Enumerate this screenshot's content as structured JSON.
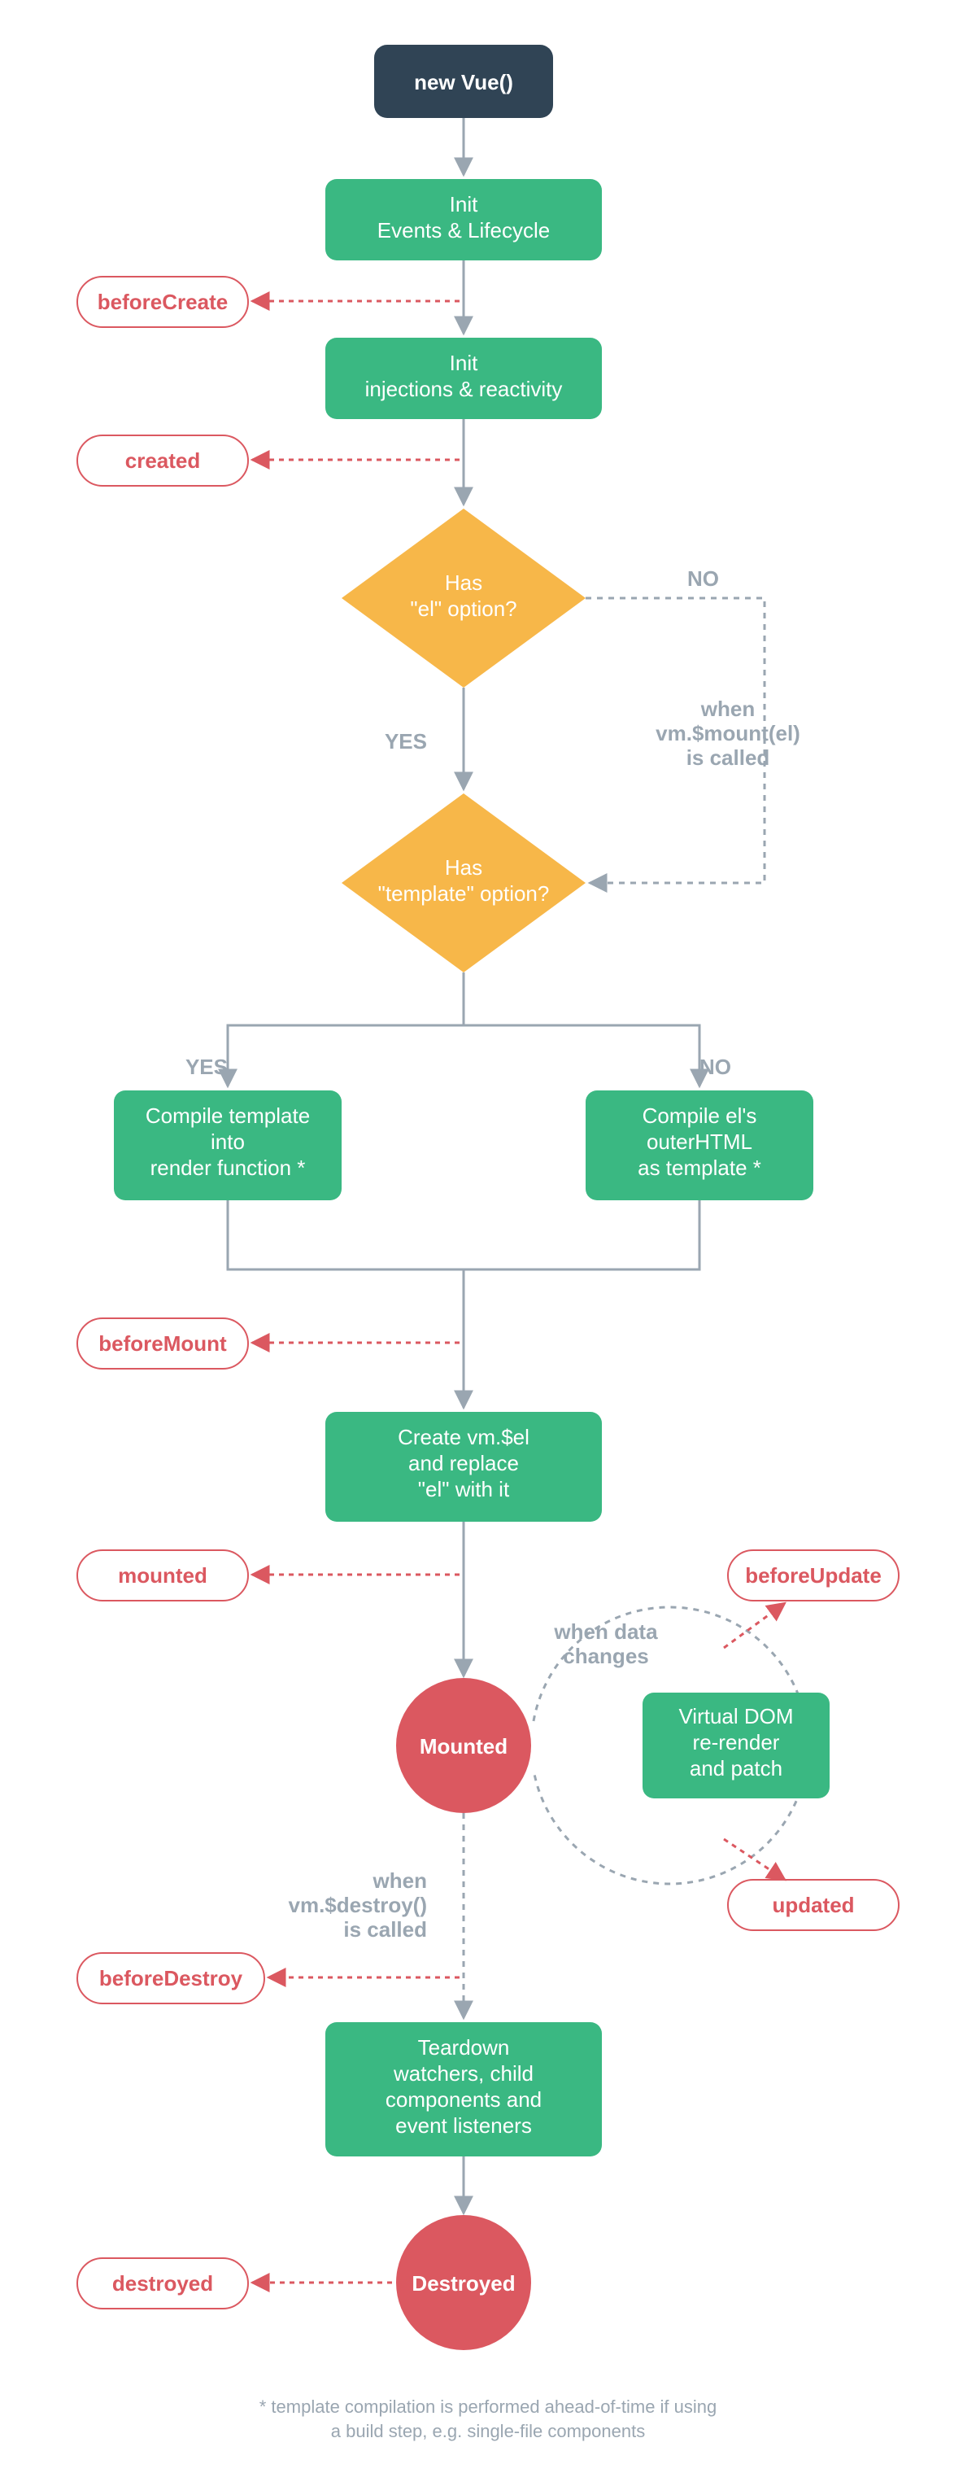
{
  "start": "new Vue()",
  "greenBoxes": {
    "initEvents": [
      "Init",
      "Events & Lifecycle"
    ],
    "initReact": [
      "Init",
      "injections & reactivity"
    ],
    "compileTemplate": [
      "Compile template",
      "into",
      "render function *"
    ],
    "compileEl": [
      "Compile el's",
      "outerHTML",
      "as template *"
    ],
    "createVmEl": [
      "Create vm.$el",
      "and replace",
      "\"el\" with it"
    ],
    "virtualDom": [
      "Virtual DOM",
      "re-render",
      "and patch"
    ],
    "teardown": [
      "Teardown",
      "watchers, child",
      "components and",
      "event listeners"
    ]
  },
  "diamonds": {
    "hasEl": [
      "Has",
      "\"el\" option?"
    ],
    "hasTemplate": [
      "Has",
      "\"template\" option?"
    ]
  },
  "hooks": {
    "beforeCreate": "beforeCreate",
    "created": "created",
    "beforeMount": "beforeMount",
    "mounted": "mounted",
    "beforeUpdate": "beforeUpdate",
    "updated": "updated",
    "beforeDestroy": "beforeDestroy",
    "destroyed": "destroyed"
  },
  "circles": {
    "mounted": "Mounted",
    "destroyed": "Destroyed"
  },
  "labels": {
    "yes": "YES",
    "no": "NO",
    "whenMount": [
      "when",
      "vm.$mount(el)",
      "is called"
    ],
    "whenData": [
      "when data",
      "changes"
    ],
    "whenDestroy": [
      "when",
      "vm.$destroy()",
      "is called"
    ]
  },
  "footnote": [
    "* template compilation is performed ahead-of-time if using",
    "a build step, e.g. single-file components"
  ]
}
